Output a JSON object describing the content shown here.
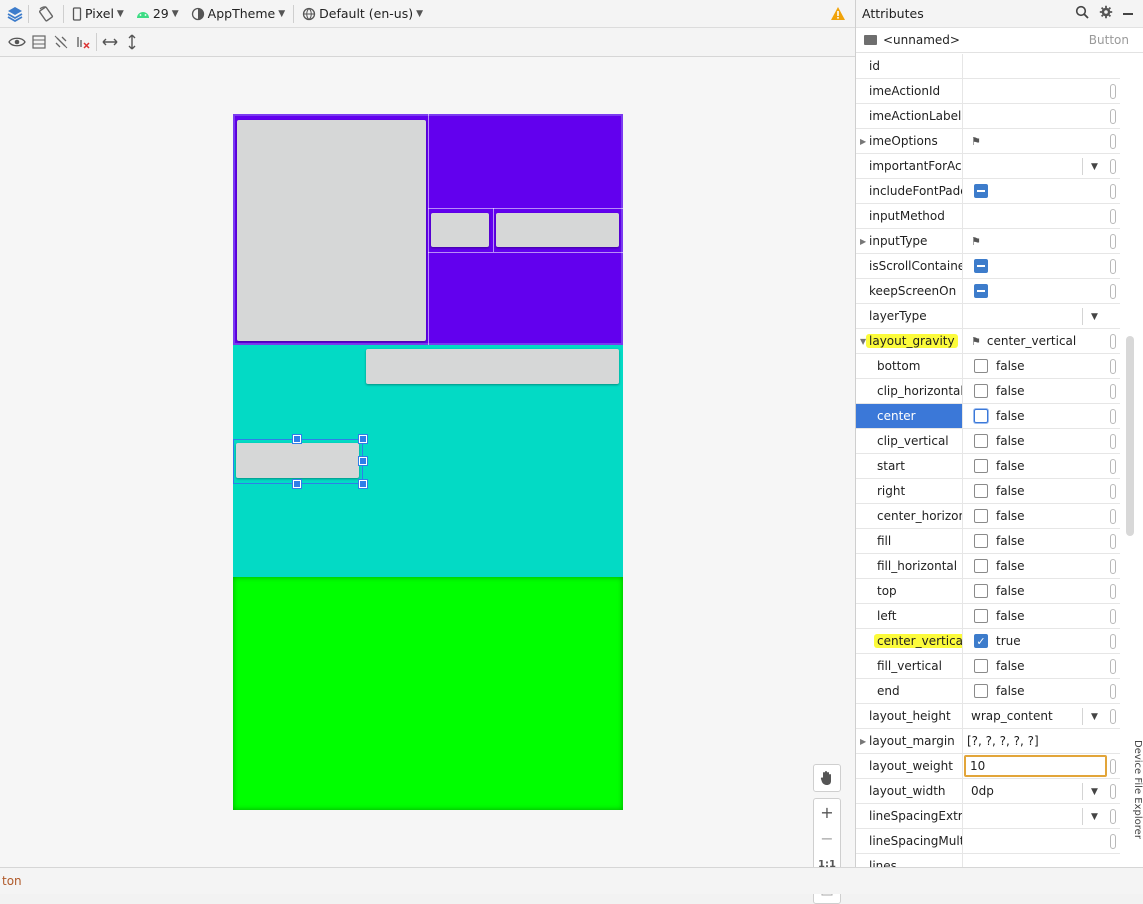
{
  "toolbar": {
    "device": "Pixel",
    "api": "29",
    "theme": "AppTheme",
    "locale": "Default (en-us)"
  },
  "attributes": {
    "title": "Attributes",
    "component_name": "<unnamed>",
    "component_class": "Button",
    "rows": {
      "id": {
        "key": "id"
      },
      "imeActionId": {
        "key": "imeActionId"
      },
      "imeActionLabel": {
        "key": "imeActionLabel"
      },
      "imeOptions": {
        "key": "imeOptions"
      },
      "importantForAcc": {
        "key": "importantForAcc..."
      },
      "includeFontPadd": {
        "key": "includeFontPadd..."
      },
      "inputMethod": {
        "key": "inputMethod"
      },
      "inputType": {
        "key": "inputType"
      },
      "isScrollContainer": {
        "key": "isScrollContainer"
      },
      "keepScreenOn": {
        "key": "keepScreenOn"
      },
      "layerType": {
        "key": "layerType"
      },
      "layout_gravity": {
        "key": "layout_gravity",
        "value": "center_vertical"
      },
      "bottom": {
        "key": "bottom",
        "value": "false"
      },
      "clip_horizontal": {
        "key": "clip_horizontal",
        "value": "false"
      },
      "center": {
        "key": "center",
        "value": "false"
      },
      "clip_vertical": {
        "key": "clip_vertical",
        "value": "false"
      },
      "start": {
        "key": "start",
        "value": "false"
      },
      "right": {
        "key": "right",
        "value": "false"
      },
      "center_horizontal": {
        "key": "center_horizon...",
        "value": "false"
      },
      "fill": {
        "key": "fill",
        "value": "false"
      },
      "fill_horizontal": {
        "key": "fill_horizontal",
        "value": "false"
      },
      "top": {
        "key": "top",
        "value": "false"
      },
      "left": {
        "key": "left",
        "value": "false"
      },
      "center_vertical": {
        "key": "center_vertical",
        "value": "true"
      },
      "fill_vertical": {
        "key": "fill_vertical",
        "value": "false"
      },
      "end": {
        "key": "end",
        "value": "false"
      },
      "layout_height": {
        "key": "layout_height",
        "value": "wrap_content"
      },
      "layout_margin": {
        "key": "layout_margin",
        "value": "[?, ?, ?, ?, ?]"
      },
      "layout_weight": {
        "key": "layout_weight",
        "value": "10"
      },
      "layout_width": {
        "key": "layout_width",
        "value": "0dp"
      },
      "lineSpacingExtra": {
        "key": "lineSpacingExtra"
      },
      "lineSpacingMulti": {
        "key": "lineSpacingMulti..."
      },
      "lines": {
        "key": "lines"
      }
    }
  },
  "zoom": {
    "reset_label": "1:1"
  },
  "side_tab": "Device File Explorer",
  "status": {
    "text": "ton"
  },
  "colors": {
    "purple": "#6200ee",
    "teal": "#03dac5",
    "green": "#00ff00",
    "selection": "#3b78d8",
    "highlight": "#fcfb3b"
  }
}
